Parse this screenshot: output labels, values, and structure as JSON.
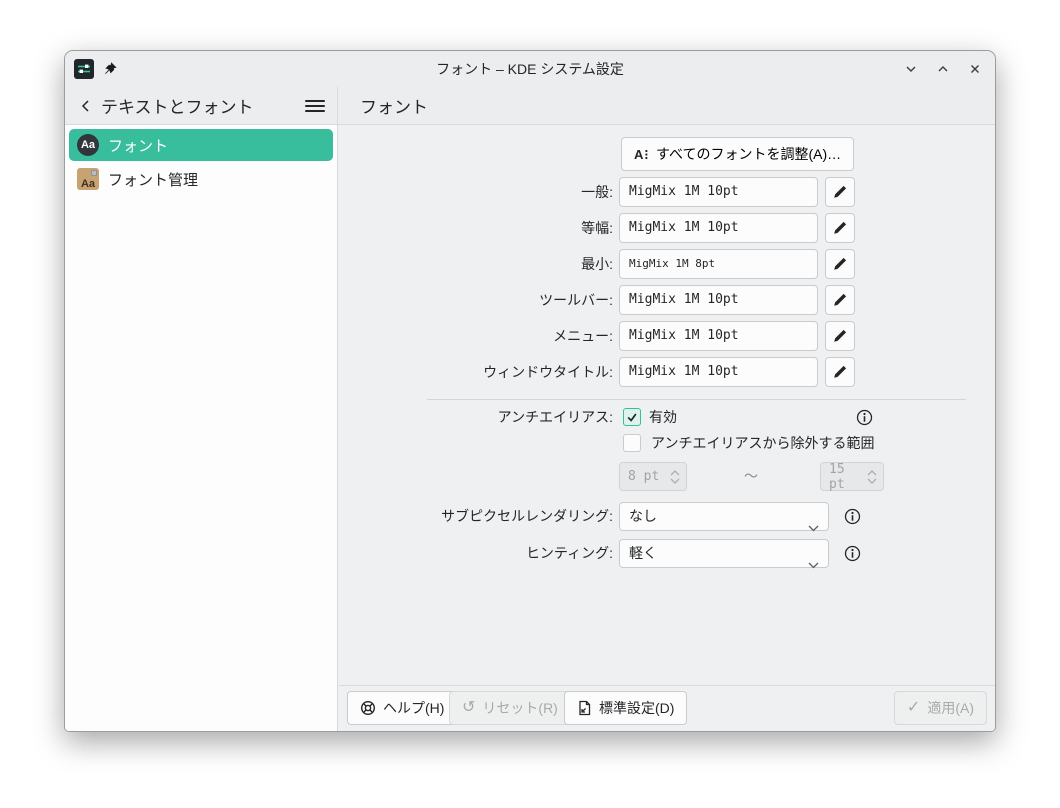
{
  "window": {
    "title": "フォント – KDE システム設定"
  },
  "header": {
    "back_label": "テキストとフォント",
    "page_title": "フォント"
  },
  "sidebar": {
    "items": [
      {
        "label": "フォント",
        "selected": true
      },
      {
        "label": "フォント管理",
        "selected": false
      }
    ]
  },
  "main": {
    "adjust_all_button": "すべてのフォントを調整(A)…",
    "font_rows": [
      {
        "label": "一般:",
        "value": "MigMix 1M 10pt"
      },
      {
        "label": "等幅:",
        "value": "MigMix 1M 10pt"
      },
      {
        "label": "最小:",
        "value": "MigMix 1M 8pt"
      },
      {
        "label": "ツールバー:",
        "value": "MigMix 1M 10pt"
      },
      {
        "label": "メニュー:",
        "value": "MigMix 1M 10pt"
      },
      {
        "label": "ウィンドウタイトル:",
        "value": "MigMix 1M 10pt"
      }
    ],
    "antialiasing": {
      "label": "アンチエイリアス:",
      "enabled_label": "有効",
      "enabled_checked": true,
      "exclude_label": "アンチエイリアスから除外する範囲",
      "exclude_checked": false,
      "range_from": "8 pt",
      "range_separator": "～",
      "range_to": "15 pt"
    },
    "subpixel": {
      "label": "サブピクセルレンダリング:",
      "value": "なし"
    },
    "hinting": {
      "label": "ヒンティング:",
      "value": "軽く"
    }
  },
  "footer": {
    "help": "ヘルプ(H)",
    "reset": "リセット(R)",
    "defaults": "標準設定(D)",
    "apply": "適用(A)",
    "reset_icon": "↺",
    "apply_icon": "✓"
  },
  "colors": {
    "accent": "#38bd9d",
    "window_bg": "#eff0f1",
    "titlebar_bg": "#ebedee",
    "sidebar_bg": "#fdfdfd"
  }
}
